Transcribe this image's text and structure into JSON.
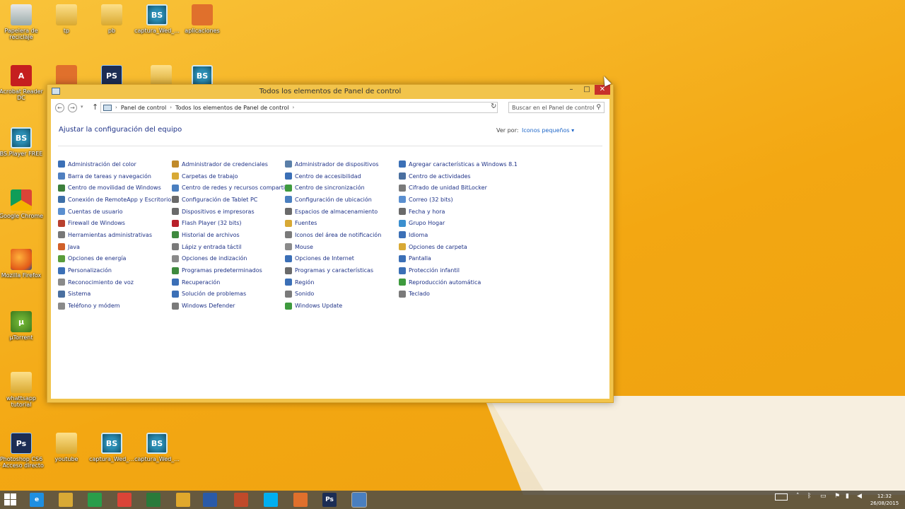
{
  "desktop": {
    "icons": [
      {
        "label": "Papelera de reciclaje",
        "icon": "recycle-bin-icon"
      },
      {
        "label": "tp",
        "icon": "folder-icon"
      },
      {
        "label": "pb",
        "icon": "folder-icon"
      },
      {
        "label": "captura_Wed_...",
        "icon": "bsplayer-icon"
      },
      {
        "label": "aplicaciones",
        "icon": "app-icon"
      },
      {
        "label": "Acrobat Reader DC",
        "icon": "pdf-icon"
      },
      {
        "label": "",
        "icon": "app-icon"
      },
      {
        "label": "PS",
        "icon": "photoshop-icon"
      },
      {
        "label": "",
        "icon": "folder-icon"
      },
      {
        "label": "BS",
        "icon": "bsplayer-icon"
      },
      {
        "label": "BS.Player FREE",
        "icon": "bsplayer-icon"
      },
      {
        "label": "Google Chrome",
        "icon": "chrome-icon"
      },
      {
        "label": "Mozilla Firefox",
        "icon": "firefox-icon"
      },
      {
        "label": "µTorrent",
        "icon": "utorrent-icon"
      },
      {
        "label": "whattsapp tutorial",
        "icon": "folder-icon"
      },
      {
        "label": "Photoshop CS6 - Acceso directo",
        "icon": "photoshop-icon"
      },
      {
        "label": "youtube",
        "icon": "folder-icon"
      },
      {
        "label": "captura_Wed_...",
        "icon": "bsplayer-icon"
      },
      {
        "label": "captura_Wed_...",
        "icon": "bsplayer-icon"
      }
    ]
  },
  "window": {
    "title": "Todos los elementos de Panel de control",
    "min_label": "–",
    "max_label": "□",
    "close_label": "✕",
    "address": {
      "crumbs": [
        "Panel de control",
        "Todos los elementos de Panel de control"
      ]
    },
    "search": {
      "placeholder": "Buscar en el Panel de control"
    },
    "page_title": "Ajustar la configuración del equipo",
    "view_by_label": "Ver por:",
    "view_by_value": "Iconos pequeños",
    "columns": [
      [
        {
          "label": "Administración del color",
          "color": "#3b6fb6"
        },
        {
          "label": "Barra de tareas y navegación",
          "color": "#4f7fc0"
        },
        {
          "label": "Centro de movilidad de Windows",
          "color": "#3c7f3c"
        },
        {
          "label": "Conexión de RemoteApp y Escritorio",
          "color": "#3d6fa8"
        },
        {
          "label": "Cuentas de usuario",
          "color": "#5a8fd0"
        },
        {
          "label": "Firewall de Windows",
          "color": "#b8402f"
        },
        {
          "label": "Herramientas administrativas",
          "color": "#777777"
        },
        {
          "label": "Java",
          "color": "#d0602a"
        },
        {
          "label": "Opciones de energía",
          "color": "#5a9d3a"
        },
        {
          "label": "Personalización",
          "color": "#3b6fb6"
        },
        {
          "label": "Reconocimiento de voz",
          "color": "#8a8a8a"
        },
        {
          "label": "Sistema",
          "color": "#4a6fa0"
        },
        {
          "label": "Teléfono y módem",
          "color": "#8a8a8a"
        }
      ],
      [
        {
          "label": "Administrador de credenciales",
          "color": "#c08a2a"
        },
        {
          "label": "Carpetas de trabajo",
          "color": "#d8a935"
        },
        {
          "label": "Centro de redes y recursos comparti...",
          "color": "#4a7fbf"
        },
        {
          "label": "Configuración de Tablet PC",
          "color": "#6a6a6a"
        },
        {
          "label": "Dispositivos e impresoras",
          "color": "#6a6a6a"
        },
        {
          "label": "Flash Player (32 bits)",
          "color": "#b8202a"
        },
        {
          "label": "Historial de archivos",
          "color": "#3e8a3e"
        },
        {
          "label": "Lápiz y entrada táctil",
          "color": "#7a7a7a"
        },
        {
          "label": "Opciones de indización",
          "color": "#8a8a8a"
        },
        {
          "label": "Programas predeterminados",
          "color": "#3e8a3e"
        },
        {
          "label": "Recuperación",
          "color": "#3b6fb6"
        },
        {
          "label": "Solución de problemas",
          "color": "#3b6fb6"
        },
        {
          "label": "Windows Defender",
          "color": "#7a7a7a"
        }
      ],
      [
        {
          "label": "Administrador de dispositivos",
          "color": "#5a7fa8"
        },
        {
          "label": "Centro de accesibilidad",
          "color": "#3b6fb6"
        },
        {
          "label": "Centro de sincronización",
          "color": "#3e9a3e"
        },
        {
          "label": "Configuración de ubicación",
          "color": "#4a7fbf"
        },
        {
          "label": "Espacios de almacenamiento",
          "color": "#6a6a6a"
        },
        {
          "label": "Fuentes",
          "color": "#d8a935"
        },
        {
          "label": "Iconos del área de notificación",
          "color": "#7a7a7a"
        },
        {
          "label": "Mouse",
          "color": "#8a8a8a"
        },
        {
          "label": "Opciones de Internet",
          "color": "#3b6fb6"
        },
        {
          "label": "Programas y características",
          "color": "#6a6a6a"
        },
        {
          "label": "Región",
          "color": "#3b6fb6"
        },
        {
          "label": "Sonido",
          "color": "#7a7a7a"
        },
        {
          "label": "Windows Update",
          "color": "#3e9a3e"
        }
      ],
      [
        {
          "label": "Agregar características a Windows 8.1",
          "color": "#3b6fb6"
        },
        {
          "label": "Centro de actividades",
          "color": "#4a6fa0"
        },
        {
          "label": "Cifrado de unidad BitLocker",
          "color": "#7a7a7a"
        },
        {
          "label": "Correo (32 bits)",
          "color": "#5a8fd0"
        },
        {
          "label": "Fecha y hora",
          "color": "#6a6a6a"
        },
        {
          "label": "Grupo Hogar",
          "color": "#3b8fcf"
        },
        {
          "label": "Idioma",
          "color": "#3b6fb6"
        },
        {
          "label": "Opciones de carpeta",
          "color": "#d8a935"
        },
        {
          "label": "Pantalla",
          "color": "#3b6fb6"
        },
        {
          "label": "Protección infantil",
          "color": "#3b6fb6"
        },
        {
          "label": "Reproducción automática",
          "color": "#3e9a3e"
        },
        {
          "label": "Teclado",
          "color": "#7a7a7a"
        }
      ]
    ]
  },
  "taskbar": {
    "apps": [
      {
        "name": "ie-icon",
        "color": "#1f8fe0",
        "label": "e"
      },
      {
        "name": "file-explorer-icon",
        "color": "#d8a935",
        "label": ""
      },
      {
        "name": "store-icon",
        "color": "#2a9d4a",
        "label": ""
      },
      {
        "name": "chrome-icon",
        "color": "#db4437",
        "label": ""
      },
      {
        "name": "excel-icon",
        "color": "#2a7a3a",
        "label": ""
      },
      {
        "name": "app-icon",
        "color": "#e0a82c",
        "label": ""
      },
      {
        "name": "word-icon",
        "color": "#2a5aa8",
        "label": ""
      },
      {
        "name": "app-icon",
        "color": "#c04a2a",
        "label": ""
      },
      {
        "name": "skype-icon",
        "color": "#00aff0",
        "label": ""
      },
      {
        "name": "app-icon",
        "color": "#e0702c",
        "label": ""
      },
      {
        "name": "photoshop-icon",
        "color": "#1c2d54",
        "label": "Ps"
      },
      {
        "name": "control-panel-icon",
        "color": "#4a7fbf",
        "label": ""
      }
    ],
    "clock_time": "12:32",
    "clock_date": "26/08/2015",
    "accent": "#5a5242"
  }
}
